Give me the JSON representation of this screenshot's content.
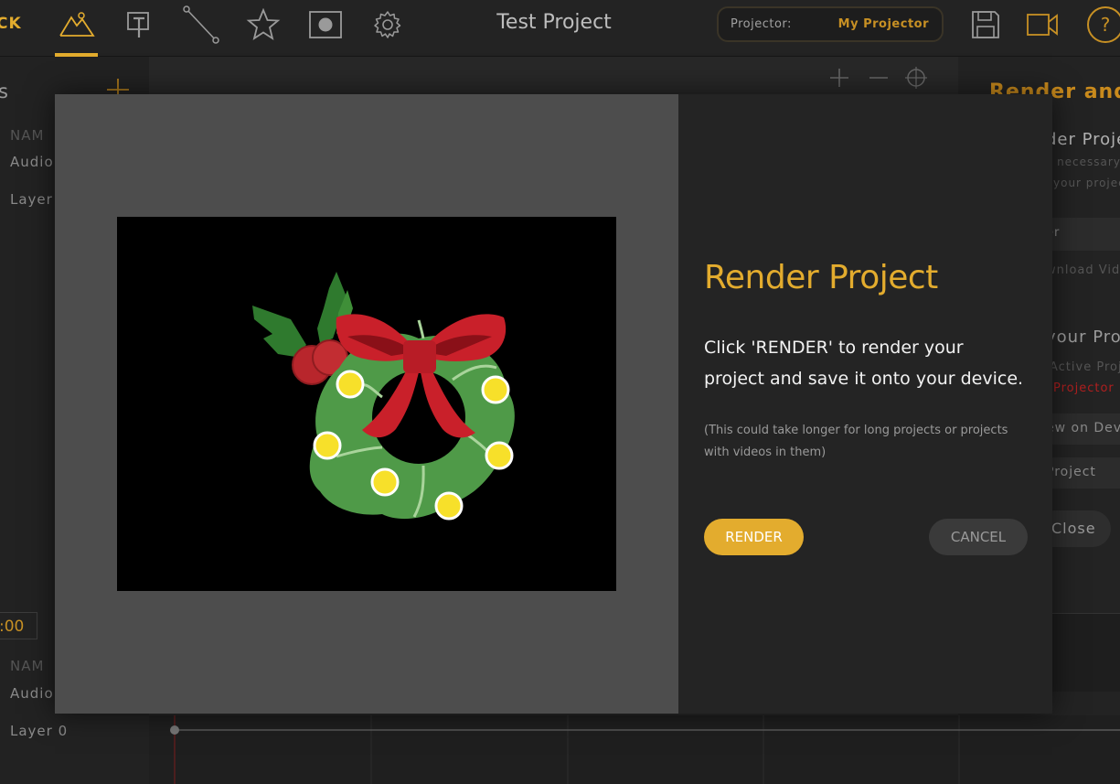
{
  "header": {
    "back_label": "CK",
    "project_title": "Test Project",
    "projector_label": "Projector:",
    "projector_value": "My Projector"
  },
  "left_panel": {
    "title_fragment": "s",
    "add_icon": "plus-icon",
    "column_header": "NAM",
    "items": [
      "Audio",
      "Layer"
    ],
    "time_value": ":00",
    "timeline_column_header": "NAM",
    "timeline_items": [
      "Audio",
      "Layer 0"
    ]
  },
  "right_panel": {
    "heading": "Render and P",
    "render_section_title": "der Projec",
    "render_section_desc_1": "s necessary t",
    "render_section_desc_2": "your projec",
    "render_button_fragment": "er",
    "download_fragment": "wnload Vide",
    "your_project_title": "your Proje",
    "active_project_label": "Active Proje",
    "active_projector": "Projector",
    "view_on_device": "ew on Dev",
    "project_button": "Project",
    "close_button": "Close"
  },
  "modal": {
    "title": "Render Project",
    "message": "Click 'RENDER' to render your project and save it onto your device.",
    "note": "(This could take longer for long projects or projects with videos in them)",
    "render_label": "RENDER",
    "cancel_label": "CANCEL"
  },
  "colors": {
    "accent": "#e3ac2e",
    "background": "#1e1e1e",
    "modal": "#242424",
    "preview_pane": "#4d4d4d",
    "wreath_green": "#4f9a48",
    "bow_red": "#c9202a",
    "light_yellow": "#f7e02a"
  },
  "icons": [
    "scene-icon",
    "text-tool-icon",
    "line-tool-icon",
    "star-icon",
    "mask-icon",
    "gear-icon",
    "save-icon",
    "video-camera-icon",
    "help-icon",
    "zoom-in-icon",
    "zoom-out-icon",
    "crosshair-icon"
  ]
}
